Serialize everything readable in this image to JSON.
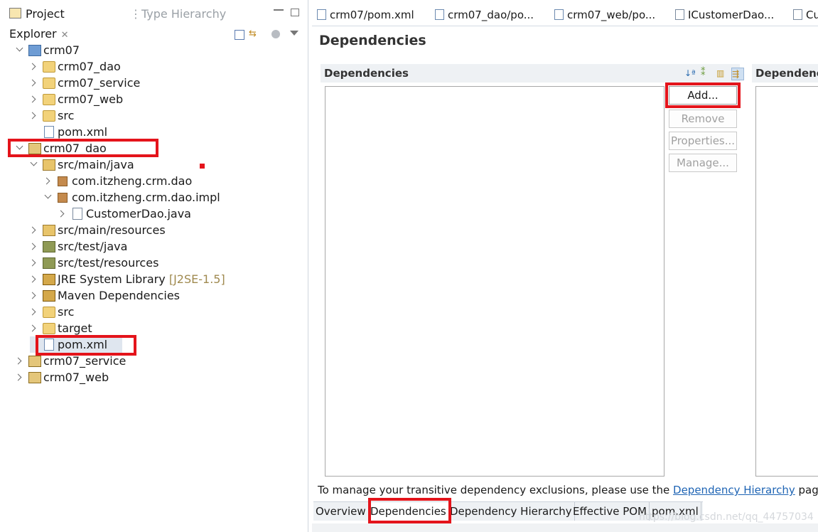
{
  "project_explorer": {
    "tab_label": "Project Explorer",
    "other_tab_label": "Type Hierarchy",
    "tree": [
      {
        "label": "crm07"
      },
      {
        "label": "crm07_dao"
      },
      {
        "label": "crm07_service"
      },
      {
        "label": "crm07_web"
      },
      {
        "label": "src"
      },
      {
        "label": "pom.xml"
      },
      {
        "label": "crm07_dao"
      },
      {
        "label": "src/main/java"
      },
      {
        "label": "com.itzheng.crm.dao"
      },
      {
        "label": "com.itzheng.crm.dao.impl"
      },
      {
        "label": "CustomerDao.java"
      },
      {
        "label": "src/main/resources"
      },
      {
        "label": "src/test/java"
      },
      {
        "label": "src/test/resources"
      },
      {
        "label": "JRE System Library",
        "suffix": "[J2SE-1.5]"
      },
      {
        "label": "Maven Dependencies"
      },
      {
        "label": "src"
      },
      {
        "label": "target"
      },
      {
        "label": "pom.xml"
      },
      {
        "label": "crm07_service"
      },
      {
        "label": "crm07_web"
      }
    ]
  },
  "editor_tabs": [
    {
      "label": "crm07/pom.xml"
    },
    {
      "label": "crm07_dao/po..."
    },
    {
      "label": "crm07_web/po..."
    },
    {
      "label": "ICustomerDao..."
    },
    {
      "label": "Cu"
    }
  ],
  "form": {
    "title": "Dependencies",
    "section_title": "Dependencies",
    "side_section_title": "Dependency",
    "buttons": {
      "add": "Add...",
      "remove": "Remove",
      "properties": "Properties...",
      "manage": "Manage..."
    },
    "note_before": "To manage your transitive dependency exclusions, please use the ",
    "note_link": "Dependency Hierarchy",
    "note_after": " page."
  },
  "page_tabs": [
    {
      "label": "Overview",
      "active": false
    },
    {
      "label": "Dependencies",
      "active": true
    },
    {
      "label": "Dependency Hierarchy",
      "active": false
    },
    {
      "label": "Effective POM",
      "active": false
    },
    {
      "label": "pom.xml",
      "active": false
    }
  ],
  "watermark": "https://blog.csdn.net/qq_44757034",
  "colors": {
    "highlight": "#e4141b",
    "link": "#1e64b4",
    "section_bg": "#eef1f4"
  }
}
